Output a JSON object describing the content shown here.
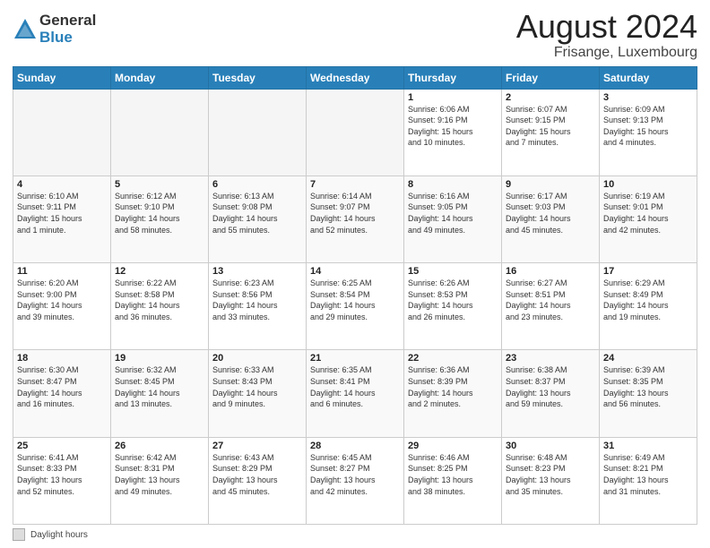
{
  "header": {
    "logo_general": "General",
    "logo_blue": "Blue",
    "month_title": "August 2024",
    "location": "Frisange, Luxembourg"
  },
  "footer": {
    "label": "Daylight hours"
  },
  "days_of_week": [
    "Sunday",
    "Monday",
    "Tuesday",
    "Wednesday",
    "Thursday",
    "Friday",
    "Saturday"
  ],
  "weeks": [
    [
      {
        "day": "",
        "info": ""
      },
      {
        "day": "",
        "info": ""
      },
      {
        "day": "",
        "info": ""
      },
      {
        "day": "",
        "info": ""
      },
      {
        "day": "1",
        "info": "Sunrise: 6:06 AM\nSunset: 9:16 PM\nDaylight: 15 hours\nand 10 minutes."
      },
      {
        "day": "2",
        "info": "Sunrise: 6:07 AM\nSunset: 9:15 PM\nDaylight: 15 hours\nand 7 minutes."
      },
      {
        "day": "3",
        "info": "Sunrise: 6:09 AM\nSunset: 9:13 PM\nDaylight: 15 hours\nand 4 minutes."
      }
    ],
    [
      {
        "day": "4",
        "info": "Sunrise: 6:10 AM\nSunset: 9:11 PM\nDaylight: 15 hours\nand 1 minute."
      },
      {
        "day": "5",
        "info": "Sunrise: 6:12 AM\nSunset: 9:10 PM\nDaylight: 14 hours\nand 58 minutes."
      },
      {
        "day": "6",
        "info": "Sunrise: 6:13 AM\nSunset: 9:08 PM\nDaylight: 14 hours\nand 55 minutes."
      },
      {
        "day": "7",
        "info": "Sunrise: 6:14 AM\nSunset: 9:07 PM\nDaylight: 14 hours\nand 52 minutes."
      },
      {
        "day": "8",
        "info": "Sunrise: 6:16 AM\nSunset: 9:05 PM\nDaylight: 14 hours\nand 49 minutes."
      },
      {
        "day": "9",
        "info": "Sunrise: 6:17 AM\nSunset: 9:03 PM\nDaylight: 14 hours\nand 45 minutes."
      },
      {
        "day": "10",
        "info": "Sunrise: 6:19 AM\nSunset: 9:01 PM\nDaylight: 14 hours\nand 42 minutes."
      }
    ],
    [
      {
        "day": "11",
        "info": "Sunrise: 6:20 AM\nSunset: 9:00 PM\nDaylight: 14 hours\nand 39 minutes."
      },
      {
        "day": "12",
        "info": "Sunrise: 6:22 AM\nSunset: 8:58 PM\nDaylight: 14 hours\nand 36 minutes."
      },
      {
        "day": "13",
        "info": "Sunrise: 6:23 AM\nSunset: 8:56 PM\nDaylight: 14 hours\nand 33 minutes."
      },
      {
        "day": "14",
        "info": "Sunrise: 6:25 AM\nSunset: 8:54 PM\nDaylight: 14 hours\nand 29 minutes."
      },
      {
        "day": "15",
        "info": "Sunrise: 6:26 AM\nSunset: 8:53 PM\nDaylight: 14 hours\nand 26 minutes."
      },
      {
        "day": "16",
        "info": "Sunrise: 6:27 AM\nSunset: 8:51 PM\nDaylight: 14 hours\nand 23 minutes."
      },
      {
        "day": "17",
        "info": "Sunrise: 6:29 AM\nSunset: 8:49 PM\nDaylight: 14 hours\nand 19 minutes."
      }
    ],
    [
      {
        "day": "18",
        "info": "Sunrise: 6:30 AM\nSunset: 8:47 PM\nDaylight: 14 hours\nand 16 minutes."
      },
      {
        "day": "19",
        "info": "Sunrise: 6:32 AM\nSunset: 8:45 PM\nDaylight: 14 hours\nand 13 minutes."
      },
      {
        "day": "20",
        "info": "Sunrise: 6:33 AM\nSunset: 8:43 PM\nDaylight: 14 hours\nand 9 minutes."
      },
      {
        "day": "21",
        "info": "Sunrise: 6:35 AM\nSunset: 8:41 PM\nDaylight: 14 hours\nand 6 minutes."
      },
      {
        "day": "22",
        "info": "Sunrise: 6:36 AM\nSunset: 8:39 PM\nDaylight: 14 hours\nand 2 minutes."
      },
      {
        "day": "23",
        "info": "Sunrise: 6:38 AM\nSunset: 8:37 PM\nDaylight: 13 hours\nand 59 minutes."
      },
      {
        "day": "24",
        "info": "Sunrise: 6:39 AM\nSunset: 8:35 PM\nDaylight: 13 hours\nand 56 minutes."
      }
    ],
    [
      {
        "day": "25",
        "info": "Sunrise: 6:41 AM\nSunset: 8:33 PM\nDaylight: 13 hours\nand 52 minutes."
      },
      {
        "day": "26",
        "info": "Sunrise: 6:42 AM\nSunset: 8:31 PM\nDaylight: 13 hours\nand 49 minutes."
      },
      {
        "day": "27",
        "info": "Sunrise: 6:43 AM\nSunset: 8:29 PM\nDaylight: 13 hours\nand 45 minutes."
      },
      {
        "day": "28",
        "info": "Sunrise: 6:45 AM\nSunset: 8:27 PM\nDaylight: 13 hours\nand 42 minutes."
      },
      {
        "day": "29",
        "info": "Sunrise: 6:46 AM\nSunset: 8:25 PM\nDaylight: 13 hours\nand 38 minutes."
      },
      {
        "day": "30",
        "info": "Sunrise: 6:48 AM\nSunset: 8:23 PM\nDaylight: 13 hours\nand 35 minutes."
      },
      {
        "day": "31",
        "info": "Sunrise: 6:49 AM\nSunset: 8:21 PM\nDaylight: 13 hours\nand 31 minutes."
      }
    ]
  ]
}
